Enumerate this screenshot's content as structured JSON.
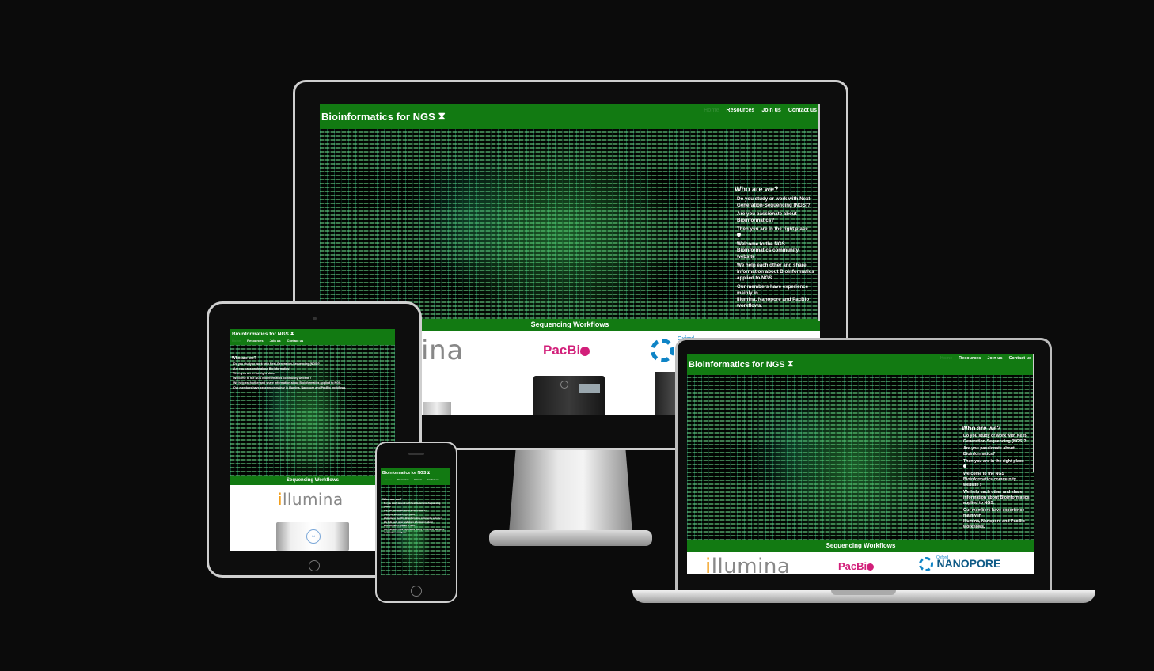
{
  "site": {
    "brand": "Bioinformatics for NGS",
    "brand_icon": "dna-icon",
    "nav": [
      "Home",
      "Resources",
      "Join us",
      "Contact us"
    ],
    "about": {
      "heading": "Who are we?",
      "lines": [
        "Do you study or work with Next-Generation-Sequencing (NGS)?",
        "Are you passionate about Bioinformatics?",
        "Then you are in the right place",
        "Welcome to the NGS Bioinformatics community website !",
        "We help each other and share information about Bioinformatics applied to NGS.",
        "Our members have experience mainly in",
        "Illumina, Nanopore and PacBio workflows."
      ]
    },
    "sections": {
      "workflows": "Sequencing Workflows"
    },
    "logos": {
      "illumina_i": "i",
      "illumina_rest": "llumina",
      "illumina_cut": "ina",
      "pacbio_pre": "PacBi",
      "nanopore_small": "Oxford",
      "nanopore_big": "NANOPORE",
      "machine_label": "bd"
    },
    "colors": {
      "green": "#127a12",
      "active_link": "#2f8a2f",
      "pacbio": "#d21f7a",
      "illumina": "#f29e1b",
      "nanopore": "#0e84c6"
    }
  }
}
